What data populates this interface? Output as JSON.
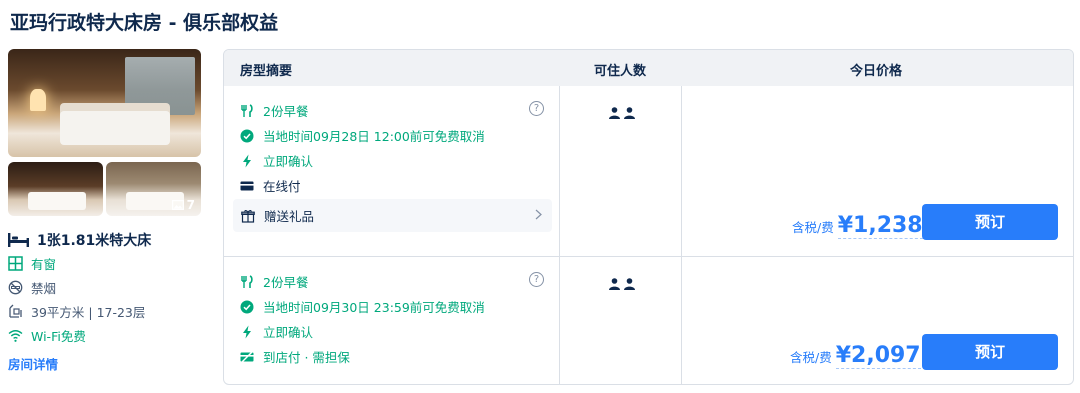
{
  "room": {
    "title": "亚玛行政特大床房 - 俱乐部权益",
    "photo_count": "7",
    "bed": "1张1.81米特大床",
    "features": [
      {
        "label": "有窗",
        "icon": "window-icon",
        "color": "#00a87c"
      },
      {
        "label": "禁烟",
        "icon": "no-smoking-icon",
        "color": "#455873"
      },
      {
        "label": "39平方米 | 17-23层",
        "icon": "area-icon",
        "color": "#455873"
      },
      {
        "label": "Wi-Fi免费",
        "icon": "wifi-icon",
        "color": "#00a87c"
      }
    ],
    "detail_link": "房间详情"
  },
  "table": {
    "headers": {
      "summary": "房型摘要",
      "guests": "可住人数",
      "price": "今日价格"
    },
    "rows": [
      {
        "meal": "2份早餐",
        "cancel": "当地时间09月28日 12:00前可免费取消",
        "confirm": "立即确认",
        "payment": "在线付",
        "gift": "赠送礼品",
        "guest_count": 2,
        "price_note": "含税/费",
        "price": "¥1,238",
        "book_label": "预订"
      },
      {
        "meal": "2份早餐",
        "cancel": "当地时间09月30日 23:59前可免费取消",
        "confirm": "立即确认",
        "payment": "到店付 · 需担保",
        "guest_count": 2,
        "price_note": "含税/费",
        "price": "¥2,097",
        "book_label": "预订"
      }
    ]
  },
  "colors": {
    "accent": "#287dfa",
    "green": "#00a87c",
    "text": "#0f294d",
    "header_bg": "#f0f2f5"
  }
}
